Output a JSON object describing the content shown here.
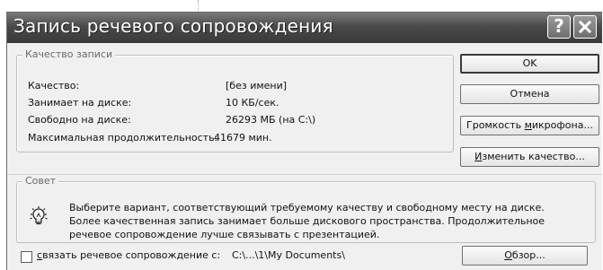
{
  "window": {
    "title": "Запись речевого сопровождения",
    "help_glyph": "?",
    "close_glyph": "X"
  },
  "quality_group": {
    "legend": "Качество записи",
    "rows": [
      {
        "label": "Качество:",
        "value": "[без имени]"
      },
      {
        "label": "Занимает на диске:",
        "value": "10 КБ/сек."
      },
      {
        "label": "Свободно на диске:",
        "value": "26293 МБ (на C:\\)"
      },
      {
        "label": "Максимальная продолжительность:",
        "value": "41679 мин."
      }
    ]
  },
  "buttons": {
    "ok": "OK",
    "cancel": "Отмена",
    "mic_volume_pre": "Громкость ",
    "mic_volume_ul": "м",
    "mic_volume_post": "икрофона...",
    "change_quality_pre": "",
    "change_quality_ul": "И",
    "change_quality_post": "зменить качество...",
    "browse_pre": "",
    "browse_ul": "О",
    "browse_post": "бзор..."
  },
  "tip_group": {
    "legend": "Совет",
    "text": "Выберите вариант, соответствующий требуемому качеству и свободному месту на диске. Более качественная запись занимает больше дискового пространства. Продолжительное речевое сопровождение лучше связывать с презентацией.",
    "icon": "lightbulb-icon"
  },
  "link_option": {
    "checked": false,
    "label_ul": "с",
    "label_rest": "вязать речевое сопровождение с:",
    "path": "C:\\...\\1\\My Documents\\"
  }
}
